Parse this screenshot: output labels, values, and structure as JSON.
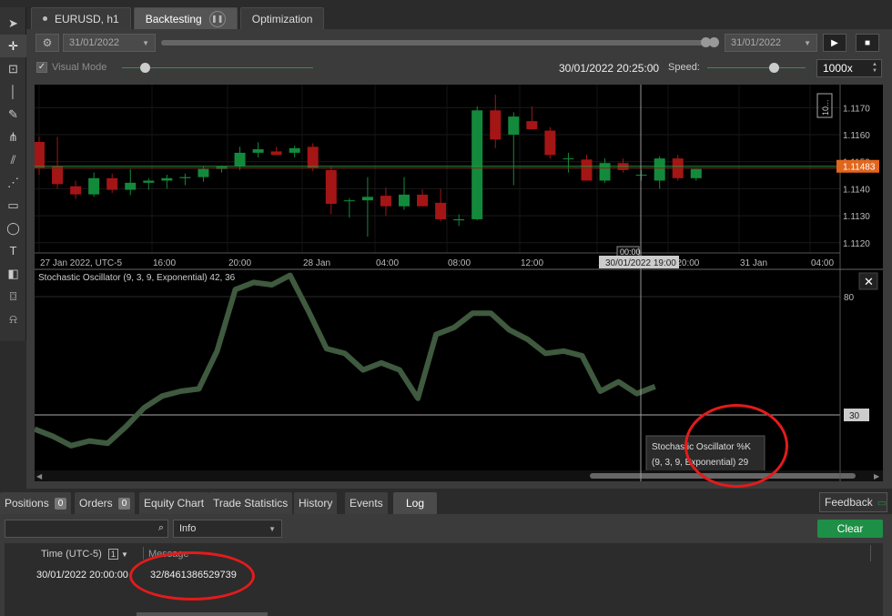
{
  "toolbar": {
    "tools": [
      "cursor-icon",
      "crosshair-icon",
      "zoom-icon",
      "vertical-line-icon",
      "pencil-icon",
      "fibonacci-icon",
      "channel-icon",
      "pattern-icon",
      "rectangle-icon",
      "ellipse-icon",
      "text-icon",
      "colorbox-icon",
      "camera-icon",
      "bell-icon"
    ]
  },
  "tabs": [
    {
      "label": "EURUSD, h1"
    },
    {
      "label": "Backtesting"
    },
    {
      "label": "Optimization"
    }
  ],
  "backtest": {
    "start_date": "31/01/2022",
    "end_date": "31/01/2022",
    "visual_mode_label": "Visual Mode",
    "current_time": "30/01/2022 20:25:00",
    "speed_label": "Speed:",
    "speed_value": "1000x",
    "progress": 0.99
  },
  "chart": {
    "x_labels": [
      "27 Jan 2022, UTC-5",
      "16:00",
      "20:00",
      "28 Jan",
      "04:00",
      "08:00",
      "12:00",
      "16:",
      "n 20:00",
      "31 Jan",
      "04:00"
    ],
    "y_labels": [
      "1.1170",
      "1.1160",
      "1.1150",
      "1.1140",
      "1.1130",
      "1.1120"
    ],
    "current_price": "1.11483",
    "crosshair_time": "30/01/2022 19:00",
    "crosshair_small": "00:00",
    "zoom_label": "10...",
    "colors": {
      "bull": "#138a3b",
      "bear": "#a41515",
      "price_line": "#2e8b3a",
      "current_price_bg": "#e2651c"
    },
    "candles": [
      {
        "o": 1.11573,
        "h": 1.11592,
        "l": 1.11452,
        "c": 1.11477
      },
      {
        "o": 1.11482,
        "h": 1.11592,
        "l": 1.114,
        "c": 1.11417
      },
      {
        "o": 1.11409,
        "h": 1.1143,
        "l": 1.11362,
        "c": 1.11379
      },
      {
        "o": 1.11379,
        "h": 1.1146,
        "l": 1.1137,
        "c": 1.11439
      },
      {
        "o": 1.11439,
        "h": 1.11456,
        "l": 1.11384,
        "c": 1.11396
      },
      {
        "o": 1.11396,
        "h": 1.11473,
        "l": 1.11376,
        "c": 1.11422
      },
      {
        "o": 1.11422,
        "h": 1.11438,
        "l": 1.11396,
        "c": 1.1143
      },
      {
        "o": 1.1143,
        "h": 1.11452,
        "l": 1.114,
        "c": 1.11439
      },
      {
        "o": 1.11439,
        "h": 1.11456,
        "l": 1.11413,
        "c": 1.11443
      },
      {
        "o": 1.11443,
        "h": 1.11482,
        "l": 1.11426,
        "c": 1.11473
      },
      {
        "o": 1.11473,
        "h": 1.11486,
        "l": 1.1146,
        "c": 1.11482
      },
      {
        "o": 1.11482,
        "h": 1.11555,
        "l": 1.11469,
        "c": 1.11533
      },
      {
        "o": 1.11533,
        "h": 1.11572,
        "l": 1.11516,
        "c": 1.11546
      },
      {
        "o": 1.11538,
        "h": 1.11555,
        "l": 1.11525,
        "c": 1.11525
      },
      {
        "o": 1.11533,
        "h": 1.11559,
        "l": 1.11516,
        "c": 1.1155
      },
      {
        "o": 1.11555,
        "h": 1.11568,
        "l": 1.11465,
        "c": 1.11477
      },
      {
        "o": 1.11469,
        "h": 1.11482,
        "l": 1.11305,
        "c": 1.11344
      },
      {
        "o": 1.11357,
        "h": 1.11365,
        "l": 1.11293,
        "c": 1.11357
      },
      {
        "o": 1.11357,
        "h": 1.11443,
        "l": 1.11223,
        "c": 1.1137
      },
      {
        "o": 1.11374,
        "h": 1.11404,
        "l": 1.113,
        "c": 1.11335
      },
      {
        "o": 1.11335,
        "h": 1.11443,
        "l": 1.11322,
        "c": 1.11378
      },
      {
        "o": 1.11378,
        "h": 1.11397,
        "l": 1.11335,
        "c": 1.11335
      },
      {
        "o": 1.11348,
        "h": 1.114,
        "l": 1.11279,
        "c": 1.11287
      },
      {
        "o": 1.11283,
        "h": 1.11305,
        "l": 1.11262,
        "c": 1.11287
      },
      {
        "o": 1.11287,
        "h": 1.11705,
        "l": 1.11283,
        "c": 1.1169
      },
      {
        "o": 1.1169,
        "h": 1.11748,
        "l": 1.1155,
        "c": 1.11582
      },
      {
        "o": 1.116,
        "h": 1.11683,
        "l": 1.11413,
        "c": 1.11667
      },
      {
        "o": 1.1165,
        "h": 1.11705,
        "l": 1.1162,
        "c": 1.1162
      },
      {
        "o": 1.11615,
        "h": 1.11628,
        "l": 1.11512,
        "c": 1.11525
      },
      {
        "o": 1.11512,
        "h": 1.11533,
        "l": 1.1146,
        "c": 1.11512
      },
      {
        "o": 1.11508,
        "h": 1.11525,
        "l": 1.1143,
        "c": 1.1143
      },
      {
        "o": 1.1143,
        "h": 1.11512,
        "l": 1.11422,
        "c": 1.11495
      },
      {
        "o": 1.11495,
        "h": 1.11512,
        "l": 1.1146,
        "c": 1.11469
      },
      {
        "o": 1.11452,
        "h": 1.11469,
        "l": 1.1143,
        "c": 1.11452
      },
      {
        "o": 1.1143,
        "h": 1.1152,
        "l": 1.114,
        "c": 1.11512
      },
      {
        "o": 1.11512,
        "h": 1.11525,
        "l": 1.1143,
        "c": 1.11439
      },
      {
        "o": 1.11439,
        "h": 1.11473,
        "l": 1.1143,
        "c": 1.11473
      }
    ]
  },
  "oscillator": {
    "title": "Stochastic Oscillator (9, 3, 9, Exponential) 42, 36",
    "levels": [
      "80",
      "30"
    ],
    "level_values": [
      80,
      30
    ],
    "ylim": [
      10,
      100
    ],
    "current_value": "30",
    "color": "#3f5a3f",
    "values": [
      24,
      21,
      17,
      19,
      18,
      25,
      33,
      38,
      40,
      41,
      57,
      83,
      86,
      85,
      89,
      74,
      58,
      56,
      49,
      52,
      49,
      37,
      64,
      67,
      73,
      73,
      66,
      62,
      56,
      57,
      55,
      40,
      44,
      39,
      42
    ],
    "tooltip_line1": "Stochastic Oscillator %K",
    "tooltip_line2": "(9, 3, 9, Exponential)  29"
  },
  "bottom_tabs": [
    {
      "label": "Positions",
      "count": "0"
    },
    {
      "label": "Orders",
      "count": "0"
    },
    {
      "label": "Equity Chart"
    },
    {
      "label": "Trade Statistics"
    },
    {
      "label": "History"
    },
    {
      "label": "Events"
    },
    {
      "label": "Log"
    }
  ],
  "feedback_label": "Feedback",
  "log": {
    "search_placeholder": "",
    "filter_value": "Info",
    "clear_label": "Clear",
    "col_time": "Time (UTC-5)",
    "col_time_badge": "1",
    "col_message": "Message",
    "rows": [
      {
        "time": "30/01/2022 20:00:00",
        "message": "32/8461386529739"
      }
    ]
  }
}
